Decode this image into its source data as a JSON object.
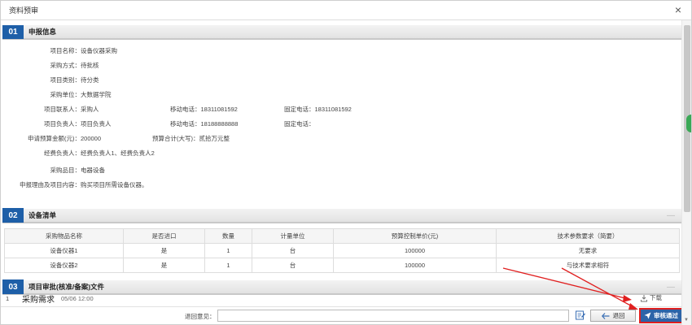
{
  "dialog": {
    "title": "资料预审"
  },
  "sections": {
    "s1": {
      "num": "01",
      "title": "申报信息"
    },
    "s2": {
      "num": "02",
      "title": "设备清单"
    },
    "s3": {
      "num": "03",
      "title": "项目审批(核准/备案)文件"
    }
  },
  "info": {
    "project_name_label": "项目名称：",
    "project_name": "设备仪器采购",
    "purchase_method_label": "采购方式：",
    "purchase_method": "待批核",
    "project_type_label": "项目类别：",
    "project_type": "待分类",
    "purchase_unit_label": "采购单位：",
    "purchase_unit": "大数据学院",
    "contact_label": "项目联系人：",
    "contact": "采购人",
    "contact_mobile_label": "移动电话：",
    "contact_mobile": "18311081592",
    "contact_phone_label": "固定电话：",
    "contact_phone": "18311081592",
    "leader_label": "项目负责人：",
    "leader": "项目负责人",
    "leader_mobile_label": "移动电话：",
    "leader_mobile": "18188888888",
    "leader_phone_label": "固定电话：",
    "leader_phone": "",
    "budget_label": "申请预算金额(元)：",
    "budget": "200000",
    "budget_total_label": "预算合计(大写)：",
    "budget_total": "贰拾万元整",
    "funds_label": "经费负责人：",
    "funds": "经费负责人1、经费负责人2",
    "category_label": "采购品目：",
    "category": "电器设备",
    "reason_label": "申报理由及项目内容：",
    "reason": "购买项目所需设备仪器。"
  },
  "devices": {
    "headers": [
      "采购物品名称",
      "是否进口",
      "数量",
      "计量单位",
      "预算控制单价(元)",
      "技术参数要求（简要）"
    ],
    "rows": [
      [
        "设备仪器1",
        "是",
        "1",
        "台",
        "100000",
        "无要求"
      ],
      [
        "设备仪器2",
        "是",
        "1",
        "台",
        "100000",
        "与技术要求相符"
      ]
    ]
  },
  "files": [
    {
      "index": "1",
      "name": "采购需求",
      "time": "05/06 12:00",
      "download_label": "下载"
    }
  ],
  "footer": {
    "return_label": "退回意见：",
    "return_value": "",
    "back_label": "退回",
    "pass_label": "审核通过"
  },
  "colors": {
    "accent": "#1e5fa8",
    "pass_button": "#2d64a8",
    "highlight": "#e02020"
  }
}
